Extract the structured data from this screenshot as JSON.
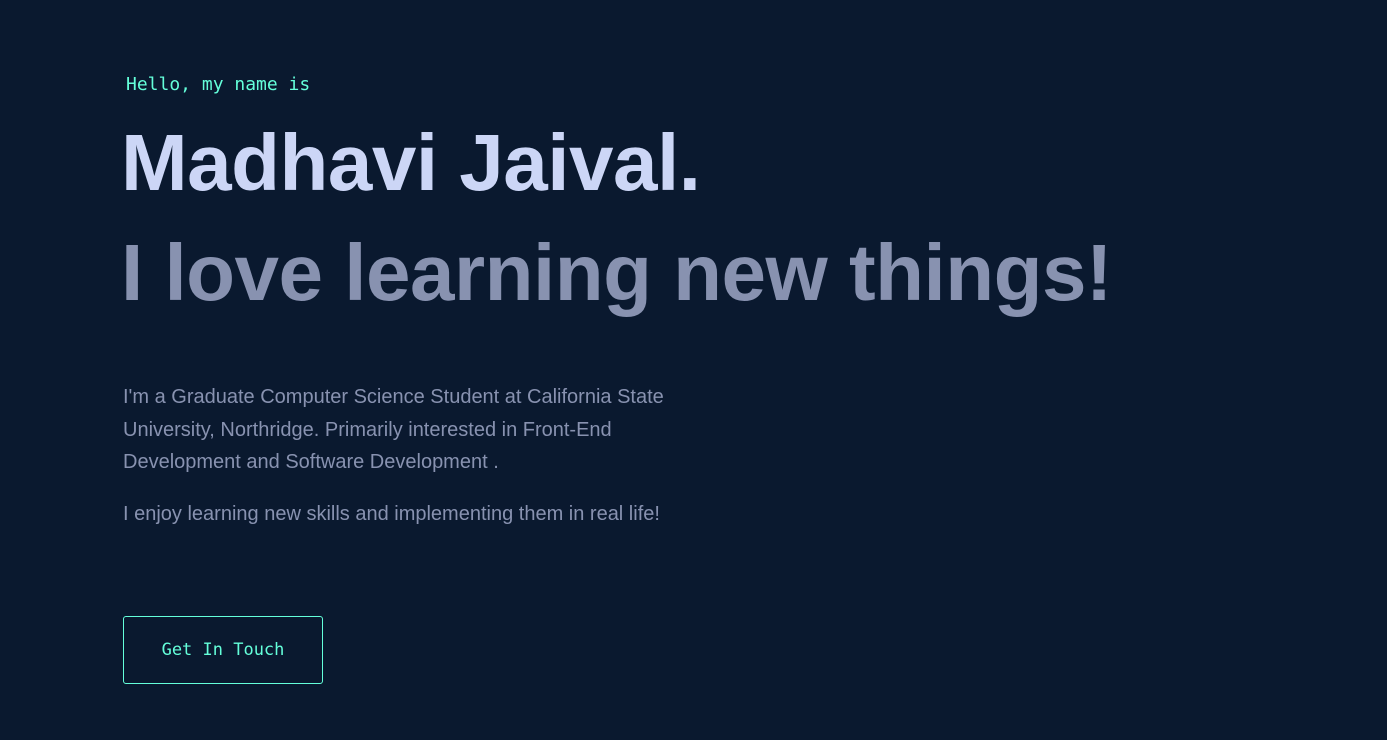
{
  "hero": {
    "greeting": "Hello, my name is",
    "name": "Madhavi Jaival.",
    "tagline": "I love learning new things!",
    "bio_paragraph_1": "I'm a Graduate Computer Science Student at California State University, Northridge. Primarily interested in Front-End Development and Software Development .",
    "bio_paragraph_2": "I enjoy learning new skills and implementing them in real life!",
    "cta_label": "Get In Touch"
  },
  "colors": {
    "background": "#0a192f",
    "accent": "#64ffda",
    "heading": "#ccd6f6",
    "body_text": "#8892b0"
  }
}
